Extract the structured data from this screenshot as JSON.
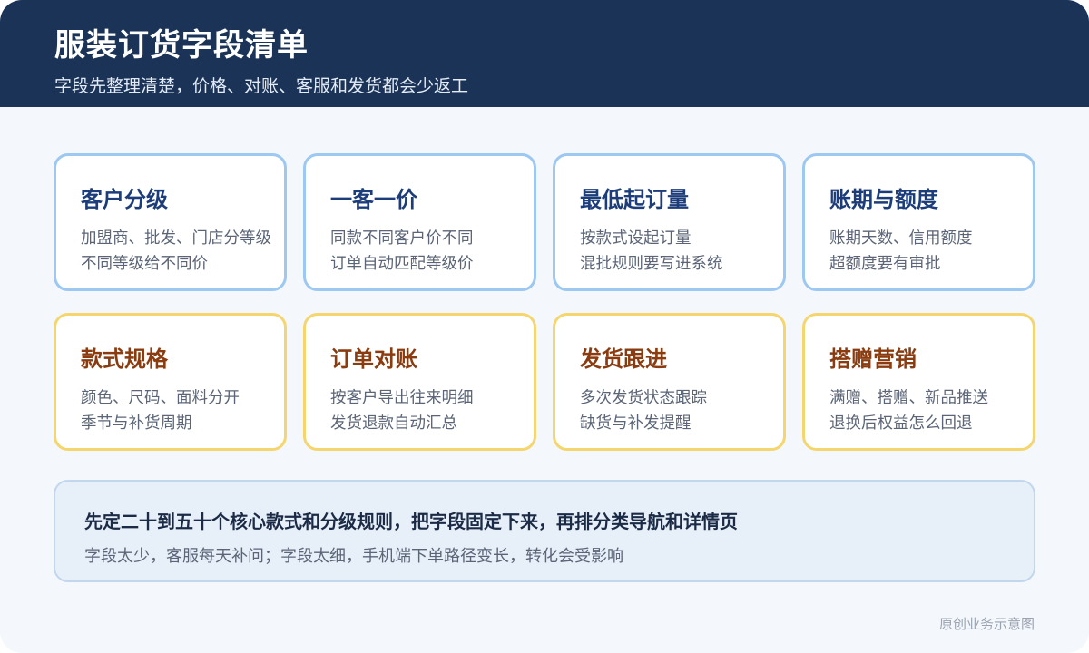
{
  "header": {
    "title": "服装订货字段清单",
    "subtitle": "字段先整理清楚，价格、对账、客服和发货都会少返工"
  },
  "cards": [
    {
      "title": "客户分级",
      "lines": [
        "加盟商、批发、门店分等级",
        "不同等级给不同价"
      ],
      "accent": "#9cc8f2"
    },
    {
      "title": "一客一价",
      "lines": [
        "同款不同客户价不同",
        "订单自动匹配等级价"
      ],
      "accent": "#9cc8f2"
    },
    {
      "title": "最低起订量",
      "lines": [
        "按款式设起订量",
        "混批规则要写进系统"
      ],
      "accent": "#9cc8f2"
    },
    {
      "title": "账期与额度",
      "lines": [
        "账期天数、信用额度",
        "超额度要有审批"
      ],
      "accent": "#9cc8f2"
    },
    {
      "title": "款式规格",
      "lines": [
        "颜色、尺码、面料分开",
        "季节与补货周期"
      ],
      "accent": "#f5d66e"
    },
    {
      "title": "订单对账",
      "lines": [
        "按客户导出往来明细",
        "发货退款自动汇总"
      ],
      "accent": "#f5d66e"
    },
    {
      "title": "发货跟进",
      "lines": [
        "多次发货状态跟踪",
        "缺货与补发提醒"
      ],
      "accent": "#f5d66e"
    },
    {
      "title": "搭赠营销",
      "lines": [
        "满赠、搭赠、新品推送",
        "退换后权益怎么回退"
      ],
      "accent": "#f5d66e"
    }
  ],
  "summary": {
    "headline": "先定二十到五十个核心款式和分级规则，把字段固定下来，再排分类导航和详情页",
    "detail": "字段太少，客服每天补问；字段太细，手机端下单路径变长，转化会受影响"
  },
  "footer": {
    "note": "原创业务示意图"
  },
  "colors": {
    "header_bg": "#1b3357",
    "blue_border": "#9cc8f2",
    "yellow_border": "#f5d66e",
    "blue_title": "#1c3d7a",
    "brown_title": "#8a3c10"
  }
}
